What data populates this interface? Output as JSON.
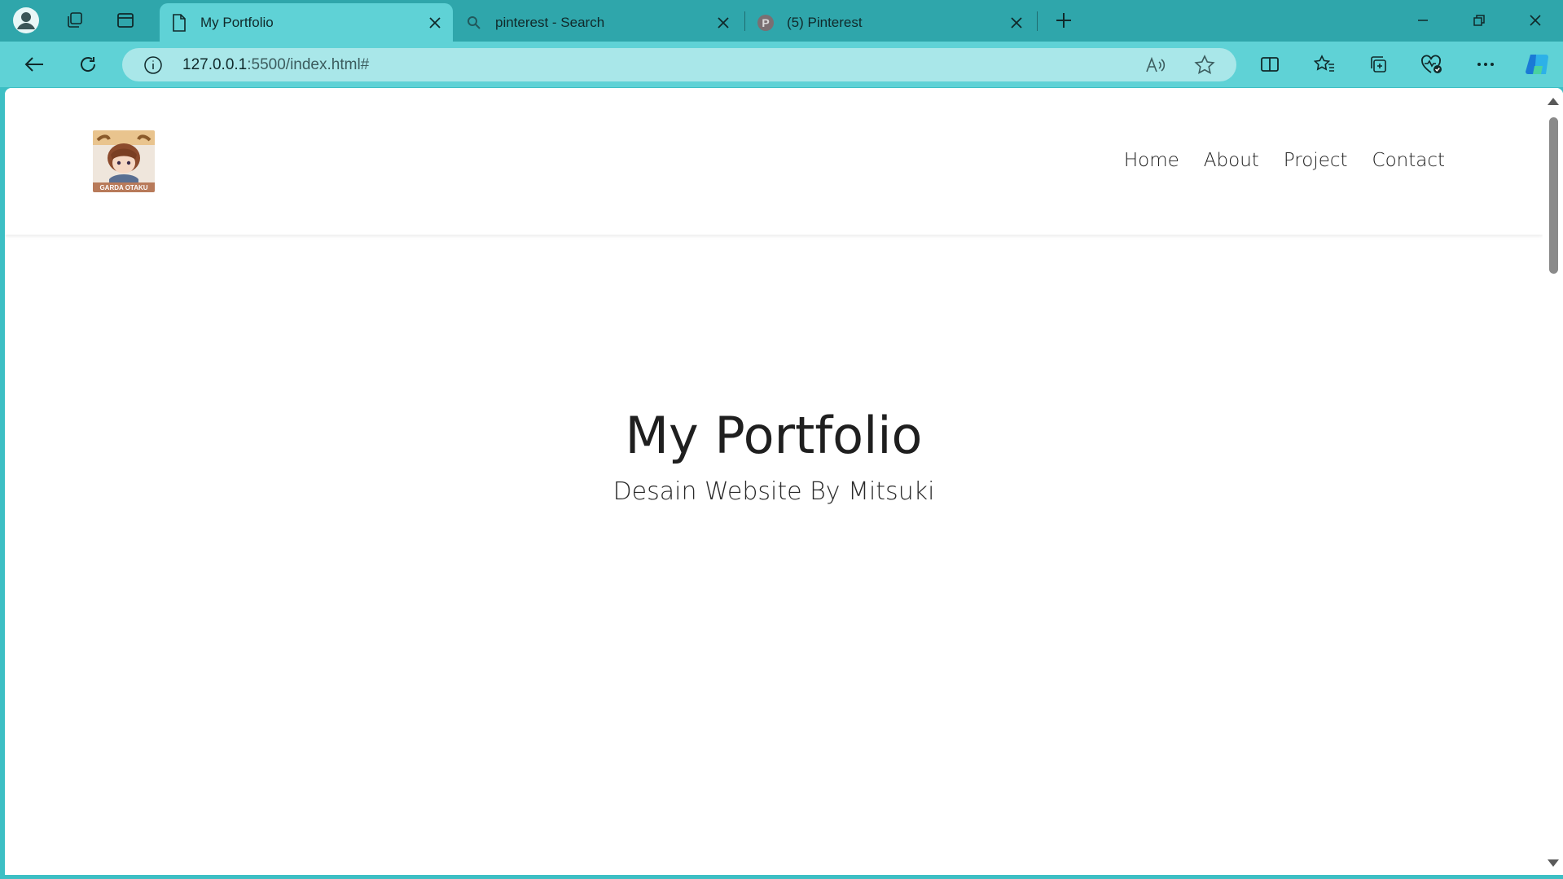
{
  "browser": {
    "tabs": [
      {
        "title": "My Portfolio",
        "icon": "page-icon",
        "active": true
      },
      {
        "title": "pinterest - Search",
        "icon": "search-icon",
        "active": false
      },
      {
        "title": "(5) Pinterest",
        "icon": "pinterest-icon",
        "active": false
      }
    ],
    "url": {
      "host": "127.0.0.1",
      "rest": ":5500/index.html#"
    },
    "colors": {
      "frame": "#2fa6ab",
      "toolbar": "#5fd2d6",
      "address": "#a9e7e9"
    }
  },
  "site": {
    "logo_text": "GARDA OTAKU",
    "nav": [
      "Home",
      "About",
      "Project",
      "Contact"
    ],
    "hero_title": "My Portfolio",
    "hero_subtitle": "Desain Website By Mitsuki"
  }
}
